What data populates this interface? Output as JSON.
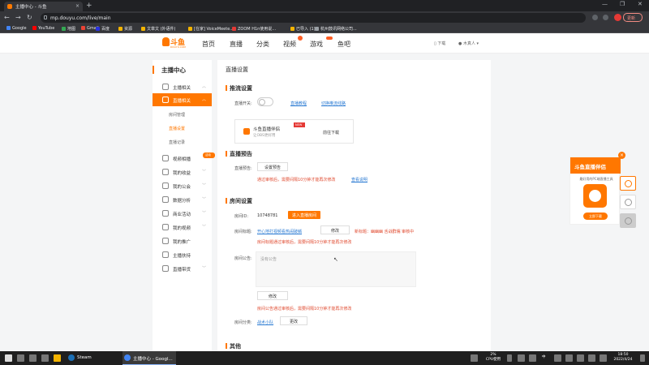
{
  "browser": {
    "tab_title": "主播中心 - 斗鱼",
    "tab_close": "×",
    "new_tab": "+",
    "url": "mp.douyu.com/live/main",
    "update_label": "更新",
    "bookmarks": [
      {
        "label": "Google",
        "color": "#4285f4"
      },
      {
        "label": "YouTube",
        "color": "#ff0000"
      },
      {
        "label": "地图",
        "color": "#34a853"
      },
      {
        "label": "Gmail",
        "color": "#ea4335"
      },
      {
        "label": "百度",
        "color": "#2932e1"
      },
      {
        "label": "资源",
        "color": "#f4b400"
      },
      {
        "label": "文章文 (外语件)",
        "color": "#f4b400"
      },
      {
        "label": "[在家] VoiceMeete...",
        "color": "#f4b400"
      },
      {
        "label": "ZOOM H1n使用说...",
        "color": "#e53935"
      },
      {
        "label": "已导入 (1)",
        "color": "#f4b400"
      },
      {
        "label": "杭州鼓讯网络公司...",
        "color": "#9aa0a6"
      }
    ]
  },
  "site": {
    "logo_text": "斗鱼",
    "logo_sub": "DOUYU.COM",
    "nav": [
      "首页",
      "直播",
      "分类",
      "视频",
      "游戏",
      "鱼吧"
    ],
    "active_nav": "直播",
    "download_label": "下载",
    "user_name": "木真人"
  },
  "sidebar": {
    "title": "主播中心",
    "items": [
      {
        "label": "主播相关",
        "arrow": "︿"
      },
      {
        "label": "直播相关",
        "arrow": "︿"
      },
      {
        "label": "视频相播",
        "arrow": ""
      },
      {
        "label": "我的收益",
        "arrow": "﹀"
      },
      {
        "label": "我的公会",
        "arrow": "﹀"
      },
      {
        "label": "数据分析",
        "arrow": "﹀"
      },
      {
        "label": "商业活动",
        "arrow": "﹀"
      },
      {
        "label": "我的视频",
        "arrow": "﹀"
      },
      {
        "label": "我的推广",
        "arrow": ""
      },
      {
        "label": "主播扶持",
        "arrow": ""
      },
      {
        "label": "直播带货",
        "arrow": "﹀"
      }
    ],
    "sub_items": [
      "房间管理",
      "直播设置",
      "直播记录"
    ],
    "hot_tag": "活动"
  },
  "main": {
    "breadcrumb": "直播设置",
    "stream": {
      "title": "推流设置",
      "switch_label": "直播开关:",
      "link1": "直播教程",
      "link2": "切换推流线路",
      "promo_title": "斗鱼直播伴侣",
      "promo_sub": "让OBS更好用",
      "promo_new": "NEW",
      "promo_btn": "前往下载"
    },
    "notice": {
      "title": "直播预告",
      "label": "直播预告:",
      "btn": "设置预告",
      "warn": "通过审核后，需要间隔10分钟才能再次修改",
      "link": "查看说明"
    },
    "room": {
      "title": "房间设置",
      "id_label": "房间ID:",
      "id_value": "10748781",
      "id_btn": "进入直播房间",
      "title_label": "房间标题:",
      "title_value": "开心地打视频看热闹破鳞",
      "title_btn": "修改",
      "subtitle": "新标题：幽幽幽 舌战群儒 审核中",
      "warn1": "房间标题通过审核后，需要间隔10分钟才能再次修改",
      "notice_label": "房间公告:",
      "notice_placeholder": "没有公告",
      "notice_btn": "修改",
      "warn2": "房间公告通过审核后，需要间隔10分钟才能再次修改",
      "category_label": "房间分类:",
      "category_value": "战术小队",
      "category_btn": "更改"
    },
    "other_title": "其他"
  },
  "float_ad": {
    "title": "斗鱼直播伴侣",
    "desc": "最好用的PC端直播工具",
    "app_name": "DOUYU",
    "download": "立即下载",
    "close": "×"
  },
  "taskbar": {
    "tasks": [
      "Steam",
      "主播中心 - Googl..."
    ],
    "cpu": "2%",
    "cpu_label": "CPU使用",
    "ime": "中",
    "time": "18:50",
    "date": "2022/4/24"
  },
  "colors": {
    "accent": "#ff7700",
    "link": "#2b7bd3",
    "warn": "#e04a2f"
  }
}
